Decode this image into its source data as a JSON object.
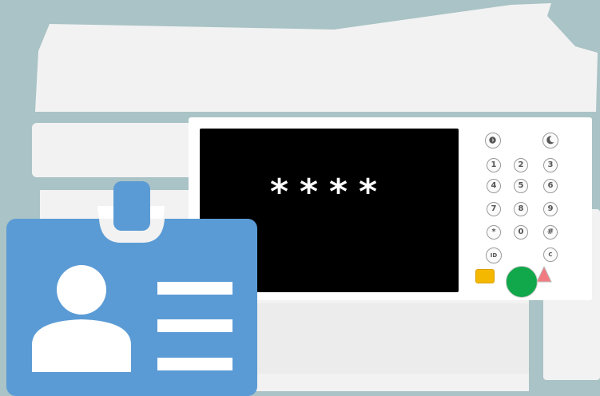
{
  "display": {
    "pin_mask": "****"
  },
  "keypad": {
    "energy_saver_icon": "energy-saver-icon",
    "sleep_icon": "moon-icon",
    "keys": [
      "1",
      "2",
      "3",
      "4",
      "5",
      "6",
      "7",
      "8",
      "9",
      "*",
      "0",
      "#"
    ],
    "id_label": "ID",
    "clear_label": "C"
  },
  "colors": {
    "background": "#a9c3c6",
    "printer_body": "#f2f2f2",
    "screen": "#000000",
    "badge": "#5b9bd5",
    "start_button": "#10a84a",
    "stop_button": "#f5b800",
    "pointer_arrow": "#f07c82"
  }
}
